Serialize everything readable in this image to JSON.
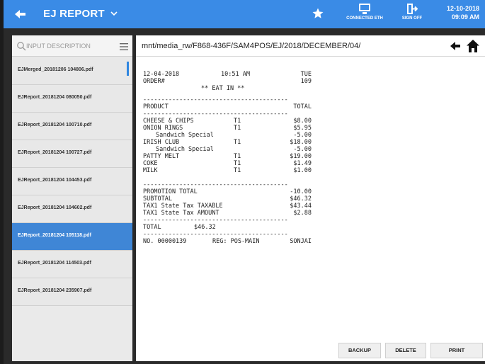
{
  "header": {
    "title": "EJ REPORT",
    "network_label": "CONNECTED ETH",
    "signoff_label": "SIGN OFF",
    "date": "12-10-2018",
    "time": "09:09 AM",
    "accent_color": "#3a8be6"
  },
  "sidebar": {
    "search_placeholder": "INPUT DESCRIPTION",
    "files": [
      "EJMerged_20181206 104806.pdf",
      "EJReport_20181204 080050.pdf",
      "EJReport_20181204 100710.pdf",
      "EJReport_20181204 100727.pdf",
      "EJReport_20181204 104453.pdf",
      "EJReport_20181204 104602.pdf",
      "EJReport_20181204 105118.pdf",
      "EJReport_20181204 114503.pdf",
      "EJReport_20181204 235907.pdf"
    ],
    "selected_index": 6
  },
  "content": {
    "path": "mnt/media_rw/F868-436F/SAM4POS/EJ/2018/DECEMBER/04/"
  },
  "receipt": {
    "date": "12-04-2018",
    "time": "10:51 AM",
    "day": "TUE",
    "order_label": "ORDER#",
    "order_no": "109",
    "mode": "** EAT IN **",
    "dashes": "----------------------------------------",
    "col_product": "PRODUCT",
    "col_total": "TOTAL",
    "items": [
      {
        "name": "CHEESE & CHIPS",
        "tax": "T1",
        "amount": "$8.00",
        "indent": false
      },
      {
        "name": "ONION RINGS",
        "tax": "T1",
        "amount": "$5.95",
        "indent": false
      },
      {
        "name": "Sandwich Special",
        "tax": "",
        "amount": "-5.00",
        "indent": true
      },
      {
        "name": "IRISH CLUB",
        "tax": "T1",
        "amount": "$18.00",
        "indent": false
      },
      {
        "name": "Sandwich Special",
        "tax": "",
        "amount": "-5.00",
        "indent": true
      },
      {
        "name": "PATTY MELT",
        "tax": "T1",
        "amount": "$19.00",
        "indent": false
      },
      {
        "name": "COKE",
        "tax": "T1",
        "amount": "$1.49",
        "indent": false
      },
      {
        "name": "MILK",
        "tax": "T1",
        "amount": "$1.00",
        "indent": false
      }
    ],
    "promotion_label": "PROMOTION TOTAL",
    "promotion_value": "-10.00",
    "subtotal_label": "SUBTOTAL",
    "subtotal_value": "$46.32",
    "taxable_label": "TAX1 State Tax TAXABLE",
    "taxable_value": "$43.44",
    "tax_amount_label": "TAX1 State Tax AMOUNT",
    "tax_amount_value": "$2.88",
    "total_label": "TOTAL",
    "total_value": "$46.32",
    "receipt_no": "NO. 00000139",
    "register": "REG: POS-MAIN",
    "cashier": "SONJAI"
  },
  "actions": {
    "backup": "BACKUP",
    "delete": "DELETE",
    "print": "PRINT"
  }
}
